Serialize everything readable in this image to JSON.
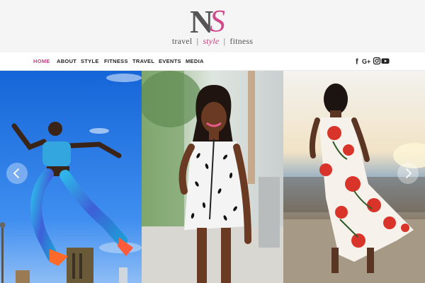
{
  "site": {
    "logo_letters": "NS",
    "tagline": [
      "travel",
      "style",
      "fitness"
    ]
  },
  "nav": {
    "items": [
      "HOME",
      "ABOUT",
      "STYLE",
      "FITNESS",
      "TRAVEL",
      "EVENTS",
      "MEDIA"
    ],
    "active": "HOME"
  },
  "social": [
    "facebook-icon",
    "google-plus-icon",
    "instagram-icon",
    "youtube-icon"
  ],
  "social_glyphs": {
    "facebook": "f",
    "google_plus": "G+"
  },
  "colors": {
    "accent": "#c2407f",
    "header_bg": "#f5f5f5"
  },
  "slides": [
    "fitness-runner-photo",
    "white-print-dress-photo",
    "red-floral-dress-photo"
  ]
}
